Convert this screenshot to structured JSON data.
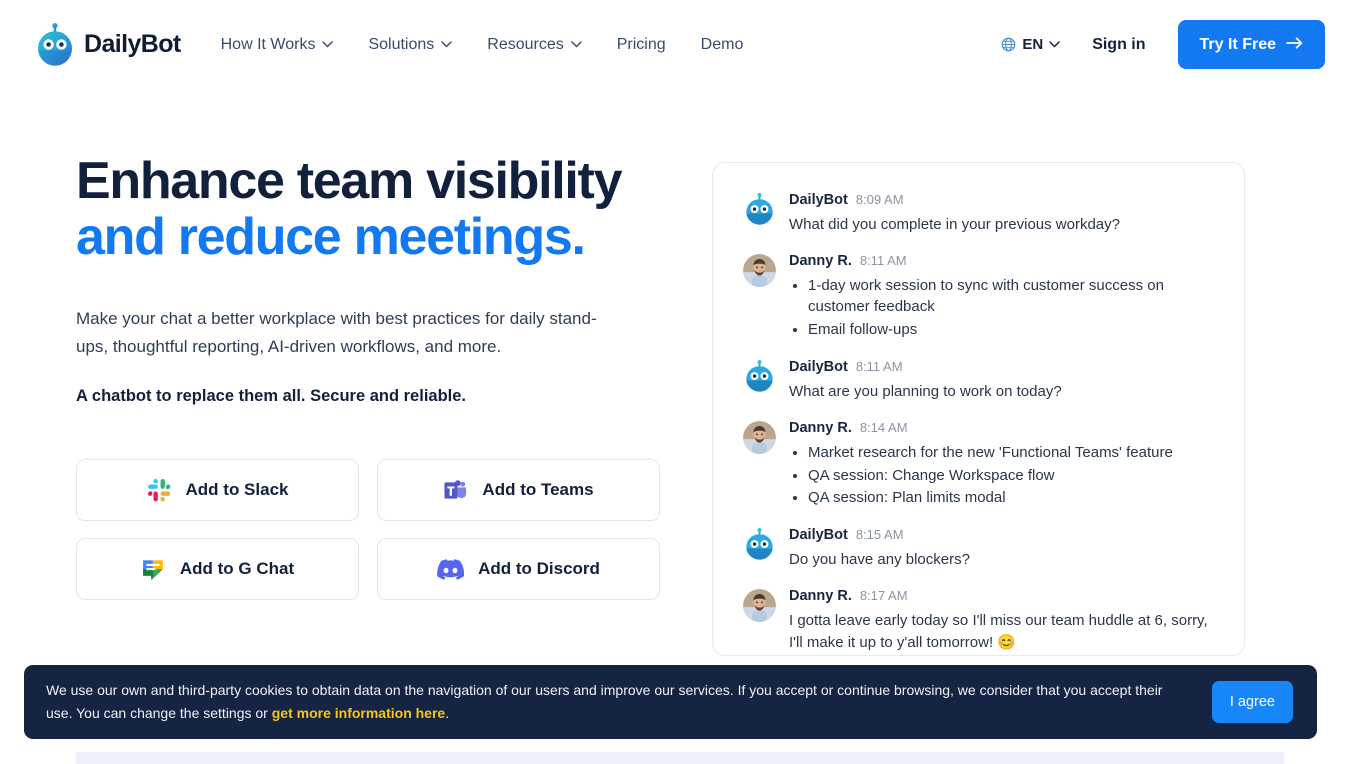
{
  "brand": {
    "name": "DailyBot",
    "logo_icon": "dailybot-robot-logo"
  },
  "nav": {
    "links": [
      {
        "label": "How It Works",
        "has_dropdown": true
      },
      {
        "label": "Solutions",
        "has_dropdown": true
      },
      {
        "label": "Resources",
        "has_dropdown": true
      },
      {
        "label": "Pricing",
        "has_dropdown": false
      },
      {
        "label": "Demo",
        "has_dropdown": false
      }
    ],
    "language": {
      "label": "EN",
      "icon": "globe-icon",
      "chevron": "chevron-down-icon"
    },
    "signin_label": "Sign in",
    "cta_label": "Try It Free",
    "cta_arrow": "arrow-right-icon",
    "cta_color": "#1279f2"
  },
  "hero": {
    "headline_line1": "Enhance team visibility",
    "headline_line2": "and reduce meetings.",
    "headline_accent_color": "#1279f2",
    "paragraph": "Make your chat a better workplace with best practices for daily stand-ups, thoughtful reporting, AI-driven workflows, and more.",
    "bold_line": "A chatbot to replace them all. Secure and reliable.",
    "buttons": [
      {
        "label": "Add to Slack",
        "icon": "slack-icon"
      },
      {
        "label": "Add to Teams",
        "icon": "microsoft-teams-icon"
      },
      {
        "label": "Add to G Chat",
        "icon": "google-chat-icon"
      },
      {
        "label": "Add to Discord",
        "icon": "discord-icon"
      }
    ]
  },
  "chat": {
    "messages": [
      {
        "author": "DailyBot",
        "time": "8:09 AM",
        "avatar": "dailybot-avatar",
        "text": "What did you complete in your previous workday?",
        "bullets": []
      },
      {
        "author": "Danny R.",
        "time": "8:11 AM",
        "avatar": "user-photo-avatar",
        "text": "",
        "bullets": [
          "1-day work session to sync with customer success on customer feedback",
          "Email follow-ups"
        ]
      },
      {
        "author": "DailyBot",
        "time": "8:11 AM",
        "avatar": "dailybot-avatar",
        "text": "What are you planning to work on today?",
        "bullets": []
      },
      {
        "author": "Danny R.",
        "time": "8:14 AM",
        "avatar": "user-photo-avatar",
        "text": "",
        "bullets": [
          "Market research for the new 'Functional Teams' feature",
          "QA session: Change Workspace flow",
          "QA session: Plan limits modal"
        ]
      },
      {
        "author": "DailyBot",
        "time": "8:15 AM",
        "avatar": "dailybot-avatar",
        "text": "Do you have any blockers?",
        "bullets": []
      },
      {
        "author": "Danny R.",
        "time": "8:17 AM",
        "avatar": "user-photo-avatar",
        "text": "I gotta leave early today so I'll miss our team huddle at 6, sorry, I'll make it up to y'all tomorrow! 😊",
        "bullets": []
      }
    ]
  },
  "cookie_banner": {
    "text_before_link": "We use our own and third-party cookies to obtain data on the navigation of our users and improve our services. If you accept or continue browsing, we consider that you accept their use. You can change the settings or ",
    "link_label": "get more information here",
    "text_after_link": ".",
    "agree_label": "I agree",
    "background": "#152443",
    "link_color": "#f5c518",
    "button_color": "#1686f8"
  }
}
